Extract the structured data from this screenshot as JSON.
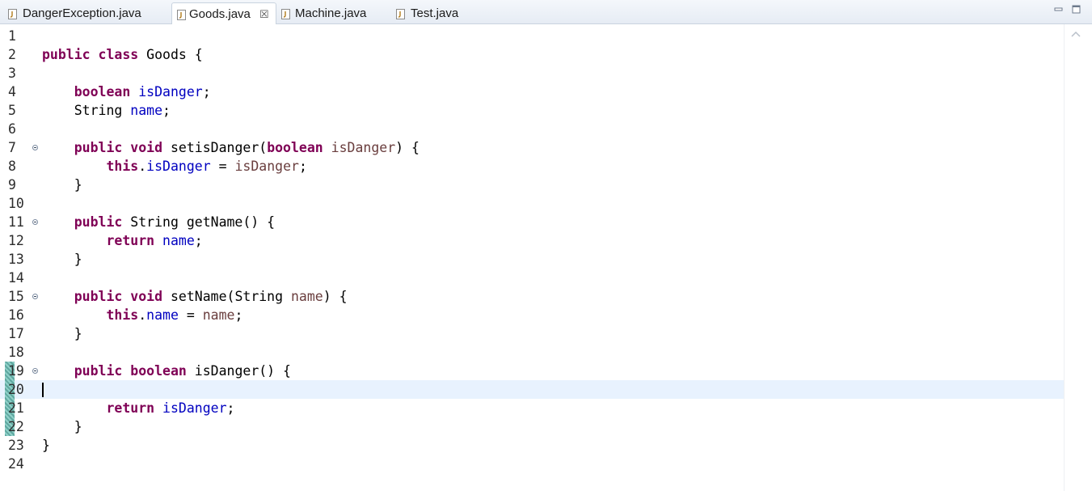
{
  "tabs": [
    {
      "label": "DangerException.java",
      "active": false
    },
    {
      "label": "Goods.java",
      "active": true,
      "close": "☒"
    },
    {
      "label": "Machine.java",
      "active": false
    },
    {
      "label": "Test.java",
      "active": false
    }
  ],
  "window_controls": {
    "minimize_icon": "minimize-icon",
    "maximize_icon": "maximize-icon"
  },
  "editor": {
    "current_line": 20,
    "lines": [
      {
        "n": "1",
        "tokens": []
      },
      {
        "n": "2",
        "tokens": [
          [
            "kw",
            "public"
          ],
          [
            "t",
            " "
          ],
          [
            "kw",
            "class"
          ],
          [
            "t",
            " Goods {"
          ]
        ]
      },
      {
        "n": "3",
        "tokens": []
      },
      {
        "n": "4",
        "tokens": [
          [
            "t",
            "    "
          ],
          [
            "kw",
            "boolean"
          ],
          [
            "t",
            " "
          ],
          [
            "fld",
            "isDanger"
          ],
          [
            "t",
            ";"
          ]
        ]
      },
      {
        "n": "5",
        "tokens": [
          [
            "t",
            "    String "
          ],
          [
            "fld",
            "name"
          ],
          [
            "t",
            ";"
          ]
        ]
      },
      {
        "n": "6",
        "tokens": []
      },
      {
        "n": "7",
        "fold": true,
        "tokens": [
          [
            "t",
            "    "
          ],
          [
            "kw",
            "public"
          ],
          [
            "t",
            " "
          ],
          [
            "kw",
            "void"
          ],
          [
            "t",
            " setisDanger("
          ],
          [
            "kw",
            "boolean"
          ],
          [
            "t",
            " "
          ],
          [
            "par",
            "isDanger"
          ],
          [
            "t",
            ") {"
          ]
        ]
      },
      {
        "n": "8",
        "tokens": [
          [
            "t",
            "        "
          ],
          [
            "kw",
            "this"
          ],
          [
            "t",
            "."
          ],
          [
            "fld",
            "isDanger"
          ],
          [
            "t",
            " = "
          ],
          [
            "par",
            "isDanger"
          ],
          [
            "t",
            ";"
          ]
        ]
      },
      {
        "n": "9",
        "tokens": [
          [
            "t",
            "    }"
          ]
        ]
      },
      {
        "n": "10",
        "tokens": []
      },
      {
        "n": "11",
        "fold": true,
        "tokens": [
          [
            "t",
            "    "
          ],
          [
            "kw",
            "public"
          ],
          [
            "t",
            " String getName() {"
          ]
        ]
      },
      {
        "n": "12",
        "tokens": [
          [
            "t",
            "        "
          ],
          [
            "kw",
            "return"
          ],
          [
            "t",
            " "
          ],
          [
            "fld",
            "name"
          ],
          [
            "t",
            ";"
          ]
        ]
      },
      {
        "n": "13",
        "tokens": [
          [
            "t",
            "    }"
          ]
        ]
      },
      {
        "n": "14",
        "tokens": []
      },
      {
        "n": "15",
        "fold": true,
        "tokens": [
          [
            "t",
            "    "
          ],
          [
            "kw",
            "public"
          ],
          [
            "t",
            " "
          ],
          [
            "kw",
            "void"
          ],
          [
            "t",
            " setName(String "
          ],
          [
            "par",
            "name"
          ],
          [
            "t",
            ") {"
          ]
        ]
      },
      {
        "n": "16",
        "tokens": [
          [
            "t",
            "        "
          ],
          [
            "kw",
            "this"
          ],
          [
            "t",
            "."
          ],
          [
            "fld",
            "name"
          ],
          [
            "t",
            " = "
          ],
          [
            "par",
            "name"
          ],
          [
            "t",
            ";"
          ]
        ]
      },
      {
        "n": "17",
        "tokens": [
          [
            "t",
            "    }"
          ]
        ]
      },
      {
        "n": "18",
        "tokens": []
      },
      {
        "n": "19",
        "fold": true,
        "changed": true,
        "tokens": [
          [
            "t",
            "    "
          ],
          [
            "kw",
            "public"
          ],
          [
            "t",
            " "
          ],
          [
            "kw",
            "boolean"
          ],
          [
            "t",
            " isDanger() {"
          ]
        ]
      },
      {
        "n": "20",
        "changed": true,
        "tokens": []
      },
      {
        "n": "21",
        "changed": true,
        "tokens": [
          [
            "t",
            "        "
          ],
          [
            "kw",
            "return"
          ],
          [
            "t",
            " "
          ],
          [
            "fld",
            "isDanger"
          ],
          [
            "t",
            ";"
          ]
        ]
      },
      {
        "n": "22",
        "changed": true,
        "tokens": [
          [
            "t",
            "    }"
          ]
        ]
      },
      {
        "n": "23",
        "tokens": [
          [
            "t",
            "}"
          ]
        ]
      },
      {
        "n": "24",
        "tokens": []
      }
    ]
  },
  "colors": {
    "keyword": "#7f0055",
    "field": "#0000c0",
    "parameter": "#6a3e3e",
    "current_line": "#e8f2fe"
  }
}
